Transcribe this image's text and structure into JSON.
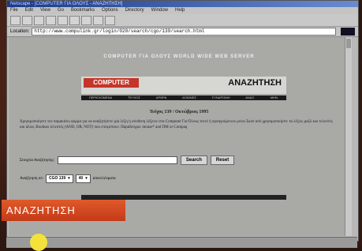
{
  "window": {
    "title": "Netscape - [COMPUTER ΓΙΑ ΟΛΟΥΣ - ΑΝΑΖΗΤΗΣΗ]"
  },
  "menu": [
    "File",
    "Edit",
    "View",
    "Go",
    "Bookmarks",
    "Options",
    "Directory",
    "Window",
    "Help"
  ],
  "address": {
    "label": "Location:",
    "value": "http://www.compulink.gr/login/020/search/cgo/139/search.html"
  },
  "page": {
    "tagline": "COMPUTER ΓΙΑ ΟΛΟΥΣ WORLD WIDE WEB SERVER",
    "brand": "COMPUTER",
    "title": "ΑΝΑΖΗΤΗΣΗ",
    "nav": [
      "ΠΕΡΙΕΧΟΜΕΝΑ",
      "ΤΕΥΧΟΣ",
      "ΑΡΘΡΑ",
      "ΔΟΚΙΜΕΣ",
      "ΣΥΝΔΡΟΜΗ",
      "ΑΝΑΖ.",
      "ΜΗΝ."
    ],
    "issue": "Τεύχος 139 / Οκτώβριος 1995",
    "intro": "Χρησιμοποιήστε τον παρακάτω φόρμα για να αναζητήσετε μία λέξη ή σύνθεση λέξεων στα Computer Για Όλους τεκτέ ή προηγούμενων μέσω Σκοπ από χρησιμοποιήστε τα λέξεις μαζύ και τελεστές και άλλα, Boolean τελεστές (AND, OR, NOT) που επιτρέπουν. Παράδειγμα: mouse* and ΠΜ or Compaq",
    "search_label": "Στοιχεία Αναζήτησης:",
    "search_button": "Search",
    "reset_button": "Reset",
    "filter_label": "Αναζήτηση σε:",
    "filter_select1": "CGO 139",
    "filter_select2": "40",
    "filter_suffix": "αποτελέσματα"
  },
  "overlay": {
    "label": "ΑΝΑΖΗΤΗΣΗ"
  }
}
